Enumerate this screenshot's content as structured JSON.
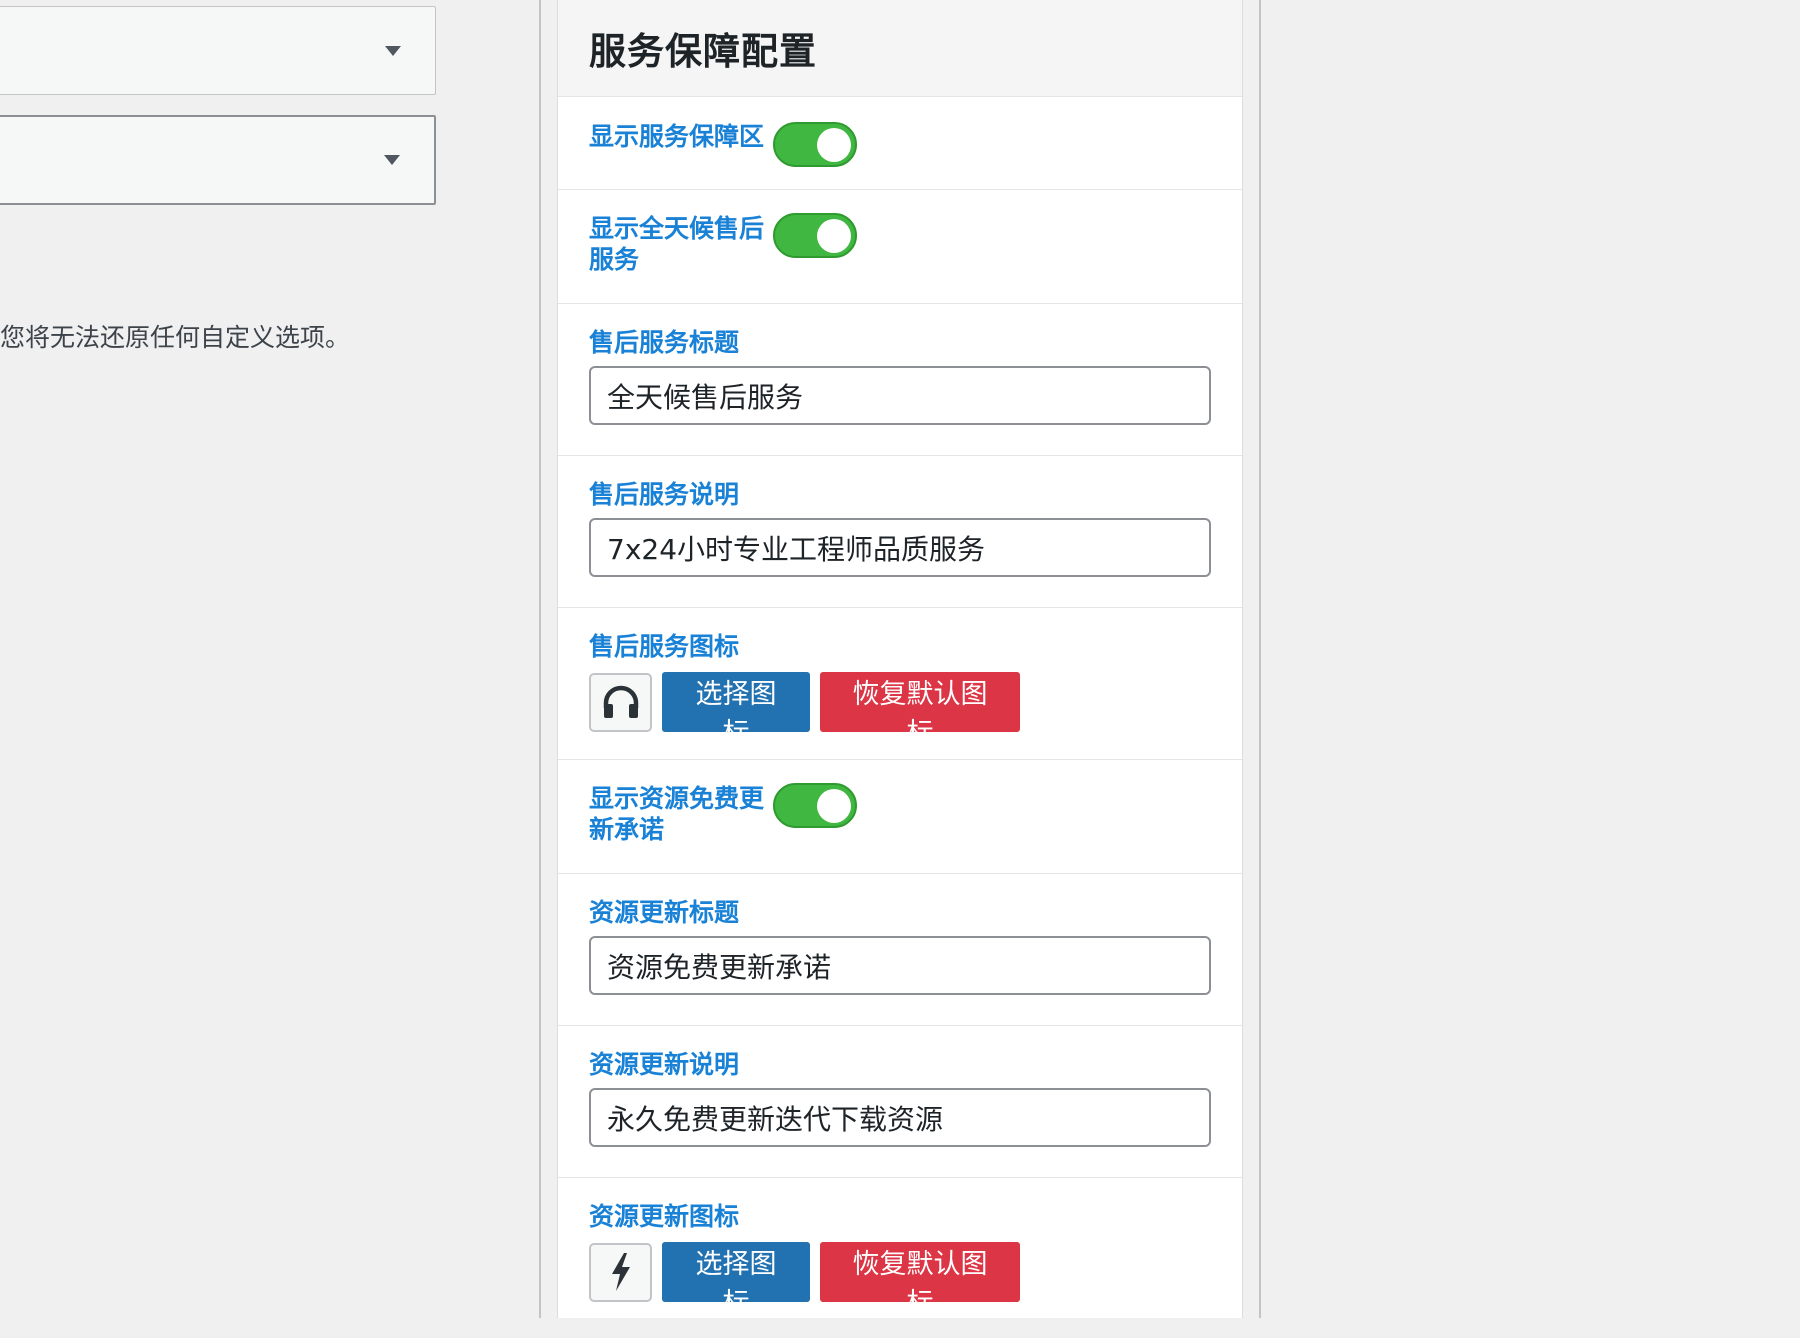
{
  "left": {
    "select1_value": "",
    "select2_value": "",
    "warning_text": "您将无法还原任何自定义选项。"
  },
  "panel": {
    "title": "服务保障配置",
    "toggles": {
      "show_service_area": {
        "label": "显示服务保障区",
        "on": true
      },
      "show_24h_service": {
        "label": "显示全天候售后服务",
        "on": true
      },
      "show_free_update": {
        "label": "显示资源免费更新承诺",
        "on": true
      }
    },
    "aftersale": {
      "title_label": "售后服务标题",
      "title_value": "全天候售后服务",
      "desc_label": "售后服务说明",
      "desc_value": "7x24小时专业工程师品质服务",
      "icon_label": "售后服务图标",
      "icon_name": "headphones-icon"
    },
    "update": {
      "title_label": "资源更新标题",
      "title_value": "资源免费更新承诺",
      "desc_label": "资源更新说明",
      "desc_value": "永久免费更新迭代下载资源",
      "icon_label": "资源更新图标",
      "icon_name": "lightning-icon"
    },
    "buttons": {
      "choose_icon": "选择图标",
      "restore_icon": "恢复默认图标"
    }
  },
  "colors": {
    "label_blue": "#1a82d6",
    "toggle_green": "#40b740",
    "button_blue": "#2271b1",
    "button_red": "#dc3545"
  }
}
